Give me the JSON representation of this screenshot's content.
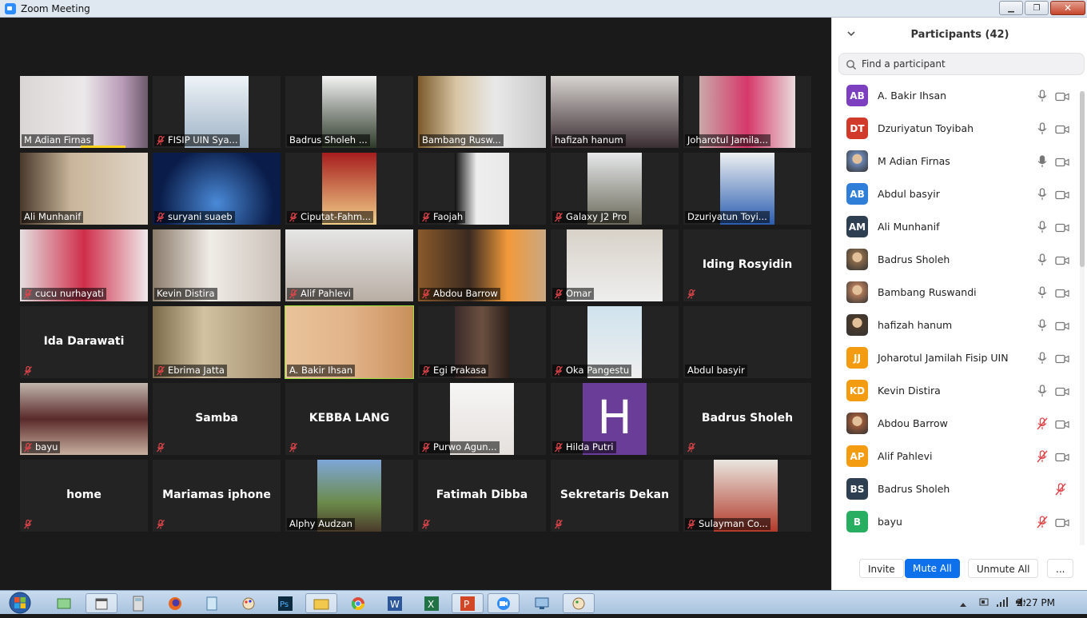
{
  "window": {
    "title": "Zoom Meeting"
  },
  "tiles": [
    {
      "name": "M Adian Firnas",
      "muted": false,
      "video": true,
      "speaking": true
    },
    {
      "name": "FISIP UIN Sya...",
      "muted": true,
      "video": true
    },
    {
      "name": "Badrus Sholeh ...",
      "muted": false,
      "video": true
    },
    {
      "name": "Bambang Rusw...",
      "muted": false,
      "video": true
    },
    {
      "name": "hafizah hanum",
      "muted": false,
      "video": true
    },
    {
      "name": "Joharotul Jamila...",
      "muted": false,
      "video": true
    },
    {
      "name": "Ali Munhanif",
      "muted": false,
      "video": true
    },
    {
      "name": "suryani suaeb",
      "muted": true,
      "video": true
    },
    {
      "name": "Ciputat-Fahm...",
      "muted": true,
      "video": true
    },
    {
      "name": "Faojah",
      "muted": true,
      "video": true
    },
    {
      "name": "Galaxy J2 Pro",
      "muted": true,
      "video": true
    },
    {
      "name": "Dzuriyatun Toyi...",
      "muted": false,
      "video": true
    },
    {
      "name": "cucu nurhayati",
      "muted": true,
      "video": true
    },
    {
      "name": "Kevin Distira",
      "muted": false,
      "video": true
    },
    {
      "name": "Alif Pahlevi",
      "muted": true,
      "video": true
    },
    {
      "name": "Abdou Barrow",
      "muted": true,
      "video": true
    },
    {
      "name": "Omar",
      "muted": true,
      "video": true
    },
    {
      "name": "",
      "display": "Iding Rosyidin",
      "muted": true,
      "video": false
    },
    {
      "name": "",
      "display": "Ida Darawati",
      "muted": true,
      "video": false
    },
    {
      "name": "Ebrima Jatta",
      "muted": true,
      "video": true
    },
    {
      "name": "A. Bakir Ihsan",
      "muted": false,
      "video": true,
      "active": true
    },
    {
      "name": "Egi Prakasa",
      "muted": true,
      "video": true
    },
    {
      "name": "Oka Pangestu",
      "muted": true,
      "video": true
    },
    {
      "name": "Abdul basyir",
      "muted": false,
      "video": false
    },
    {
      "name": "bayu",
      "muted": true,
      "video": true
    },
    {
      "name": "",
      "display": "Samba",
      "muted": true,
      "video": false
    },
    {
      "name": "",
      "display": "KEBBA LANG",
      "muted": true,
      "video": false
    },
    {
      "name": "Purwo Agun...",
      "muted": true,
      "video": true
    },
    {
      "name": "Hilda Putri",
      "muted": true,
      "video": true,
      "letter": "H"
    },
    {
      "name": "",
      "display": "Badrus Sholeh",
      "muted": true,
      "video": false
    },
    {
      "name": "",
      "display": "home",
      "muted": true,
      "video": false
    },
    {
      "name": "",
      "display": "Mariamas iphone",
      "muted": true,
      "video": false
    },
    {
      "name": "Alphy Audzan",
      "muted": false,
      "video": true
    },
    {
      "name": "",
      "display": "Fatimah Dibba",
      "muted": true,
      "video": false
    },
    {
      "name": "",
      "display": "Sekretaris Dekan",
      "muted": true,
      "video": false
    },
    {
      "name": "Sulayman Co...",
      "muted": true,
      "video": true
    }
  ],
  "participants_panel": {
    "title": "Participants (42)",
    "search_placeholder": "Find a participant",
    "list": [
      {
        "initials": "AB",
        "name": "A. Bakir Ihsan",
        "color": "#7b3fbf",
        "mic": "on",
        "cam": "on"
      },
      {
        "initials": "DT",
        "name": "Dzuriyatun Toyibah",
        "color": "#d13a2b",
        "mic": "on",
        "cam": "on"
      },
      {
        "initials": "",
        "name": "M Adian Firnas",
        "color": "#6b86b3",
        "photo": true,
        "mic": "speaking",
        "cam": "on"
      },
      {
        "initials": "AB",
        "name": "Abdul basyir",
        "color": "#2f7fd8",
        "mic": "on",
        "cam": "on"
      },
      {
        "initials": "AM",
        "name": "Ali Munhanif",
        "color": "#2f3f52",
        "mic": "on",
        "cam": "on"
      },
      {
        "initials": "",
        "name": "Badrus Sholeh",
        "color": "#8a6a4a",
        "photo": true,
        "mic": "on",
        "cam": "on"
      },
      {
        "initials": "",
        "name": "Bambang Ruswandi",
        "color": "#b07a5a",
        "photo": true,
        "mic": "on",
        "cam": "on"
      },
      {
        "initials": "",
        "name": "hafizah hanum",
        "color": "#4a3a2a",
        "photo": true,
        "mic": "on",
        "cam": "on"
      },
      {
        "initials": "JJ",
        "name": "Joharotul Jamilah Fisip UIN",
        "color": "#f39c12",
        "mic": "on",
        "cam": "on"
      },
      {
        "initials": "KD",
        "name": "Kevin Distira",
        "color": "#f39c12",
        "mic": "on",
        "cam": "on"
      },
      {
        "initials": "",
        "name": "Abdou Barrow",
        "color": "#9a5a3a",
        "photo": true,
        "mic": "muted",
        "cam": "on"
      },
      {
        "initials": "AP",
        "name": "Alif Pahlevi",
        "color": "#f39c12",
        "mic": "muted",
        "cam": "on"
      },
      {
        "initials": "BS",
        "name": "Badrus Sholeh",
        "color": "#2f3f52",
        "mic": "muted",
        "cam": "none"
      },
      {
        "initials": "B",
        "name": "bayu",
        "color": "#27ae60",
        "mic": "muted",
        "cam": "on"
      }
    ],
    "buttons": {
      "invite": "Invite",
      "mute_all": "Mute All",
      "unmute_all": "Unmute All",
      "more": "..."
    }
  },
  "taskbar": {
    "time": "2:27 PM"
  }
}
